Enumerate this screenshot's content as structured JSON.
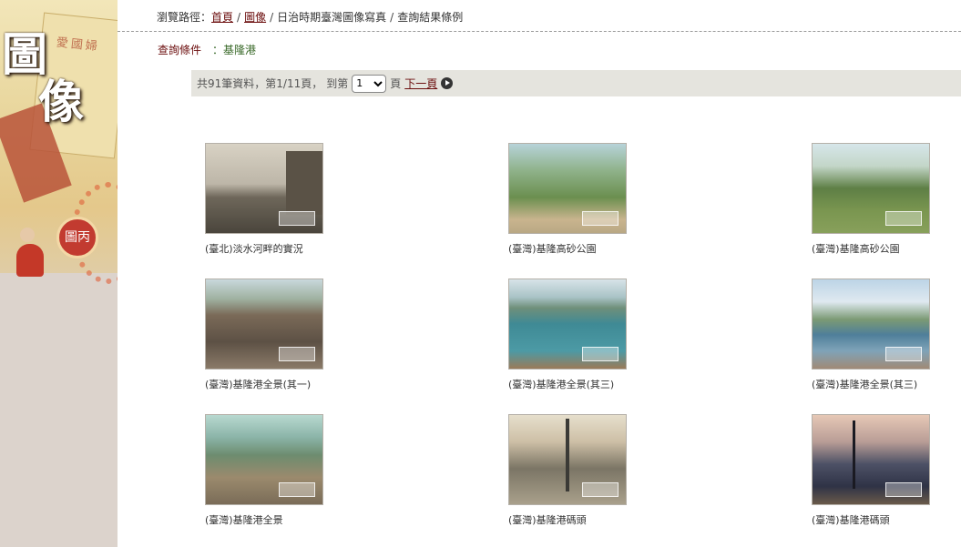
{
  "breadcrumb": {
    "prefix": "瀏覽路徑：",
    "home": "首頁",
    "images": "圖像",
    "collection": "日治時期臺灣圖像寫真",
    "current": "查詢結果條例"
  },
  "banner": {
    "glyph1": "圖",
    "glyph2": "像",
    "paper_text": "愛國婦",
    "seal_text": "圖丙"
  },
  "query": {
    "label": "查詢條件",
    "value": "：基隆港"
  },
  "pager": {
    "summary": "共91筆資料，第1/11頁，",
    "goto_label": "到第",
    "selected_page": "1",
    "page_suffix": "頁",
    "next_label": "下一頁"
  },
  "items": [
    {
      "caption": "(臺北)淡水河畔的實況"
    },
    {
      "caption": "(臺灣)基隆高砂公園"
    },
    {
      "caption": "(臺灣)基隆高砂公園"
    },
    {
      "caption": "(臺灣)基隆港全景(其一)"
    },
    {
      "caption": "(臺灣)基隆港全景(其三)"
    },
    {
      "caption": "(臺灣)基隆港全景(其三)"
    },
    {
      "caption": "(臺灣)基隆港全景"
    },
    {
      "caption": "(臺灣)基隆港碼頭"
    },
    {
      "caption": "(臺灣)基隆港碼頭"
    }
  ]
}
